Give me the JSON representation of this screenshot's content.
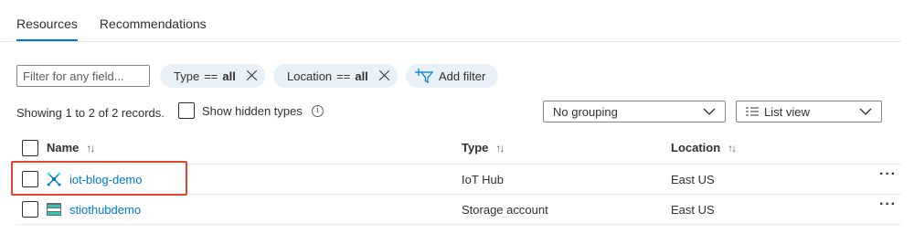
{
  "tabs": [
    {
      "label": "Resources",
      "active": true
    },
    {
      "label": "Recommendations",
      "active": false
    }
  ],
  "filter": {
    "placeholder": "Filter for any field..."
  },
  "pills": {
    "type": {
      "key": "Type",
      "op": "==",
      "value": "all"
    },
    "location": {
      "key": "Location",
      "op": "==",
      "value": "all"
    },
    "add_filter": "Add filter"
  },
  "records_text": "Showing 1 to 2 of 2 records.",
  "show_hidden_types": "Show hidden types",
  "grouping": "No grouping",
  "view": "List view",
  "columns": {
    "name": "Name",
    "type": "Type",
    "location": "Location"
  },
  "rows": [
    {
      "name": "iot-blog-demo",
      "type": "IoT Hub",
      "location": "East US",
      "icon": "iot-hub-icon"
    },
    {
      "name": "stiothubdemo",
      "type": "Storage account",
      "location": "East US",
      "icon": "storage-account-icon"
    }
  ],
  "colors": {
    "accent": "#0078d4",
    "highlight": "#e0462a",
    "pill_bg": "#e8f0f8"
  }
}
